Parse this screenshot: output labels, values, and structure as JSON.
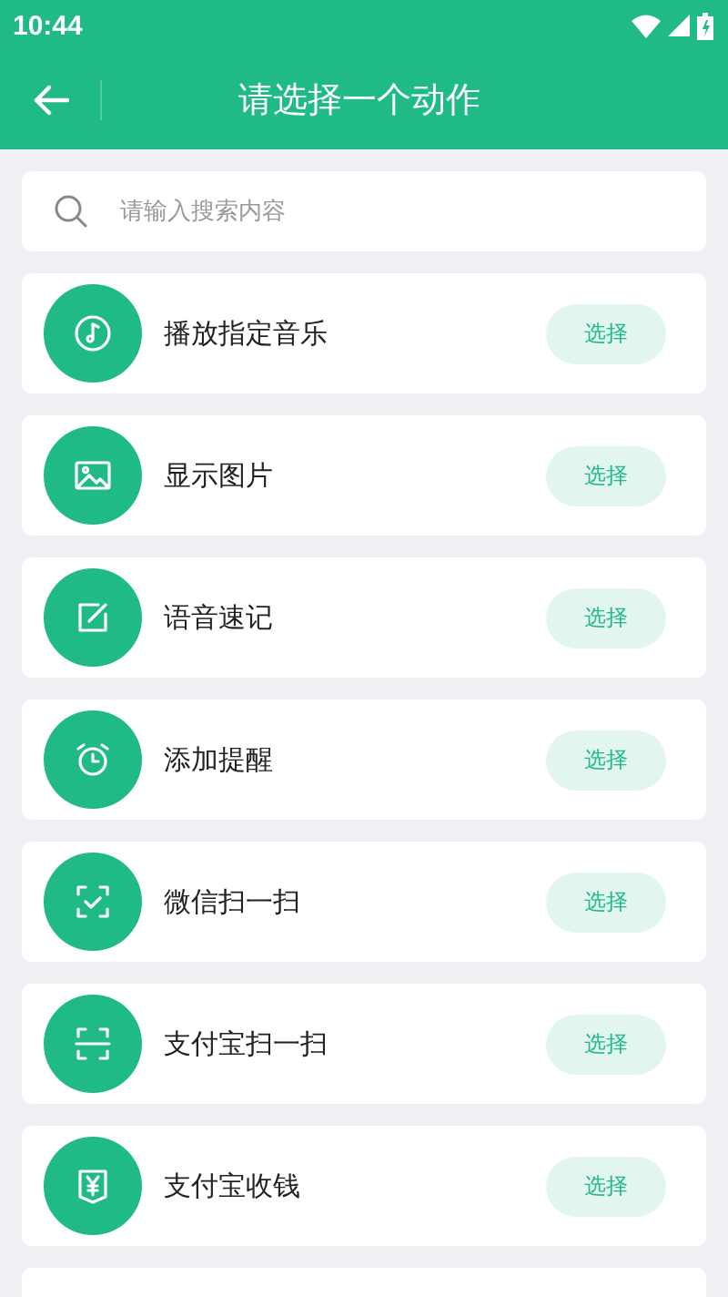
{
  "status_bar": {
    "time": "10:44"
  },
  "app_bar": {
    "title": "请选择一个动作"
  },
  "search": {
    "placeholder": "请输入搜索内容"
  },
  "actions": [
    {
      "kind": "music",
      "label": "播放指定音乐",
      "button": "选择"
    },
    {
      "kind": "image",
      "label": "显示图片",
      "button": "选择"
    },
    {
      "kind": "note",
      "label": "语音速记",
      "button": "选择"
    },
    {
      "kind": "alarm",
      "label": "添加提醒",
      "button": "选择"
    },
    {
      "kind": "scan-check",
      "label": "微信扫一扫",
      "button": "选择"
    },
    {
      "kind": "scan",
      "label": "支付宝扫一扫",
      "button": "选择"
    },
    {
      "kind": "money",
      "label": "支付宝收钱",
      "button": "选择"
    }
  ]
}
